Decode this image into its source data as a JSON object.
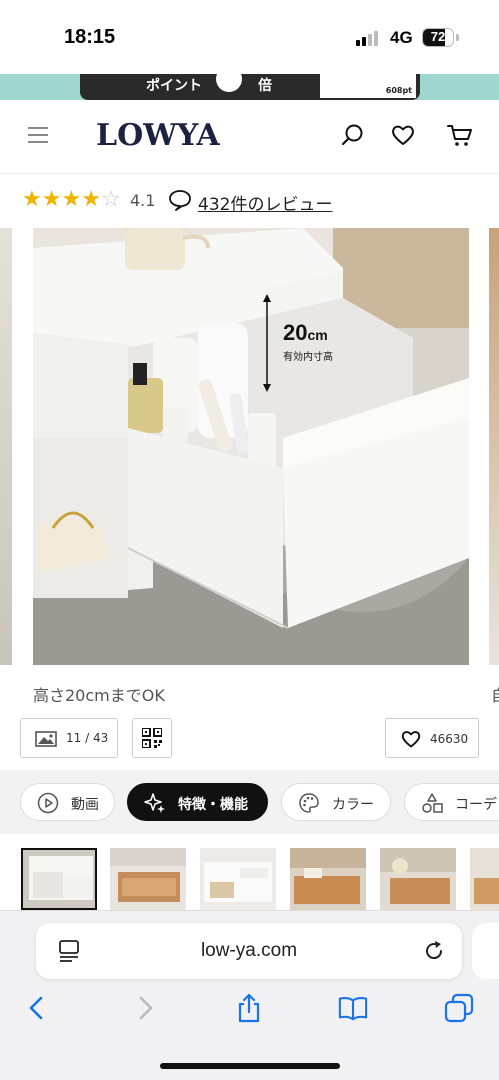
{
  "status_bar": {
    "time": "18:15",
    "network": "4G",
    "battery": "72",
    "battery_level": 0.72
  },
  "promo_banner": {
    "text_left": "ポイント",
    "text_right": "倍",
    "card_value": "608pt"
  },
  "header": {
    "logo": "LOWYA"
  },
  "rating": {
    "stars_filled": 4,
    "stars_total": 5,
    "value": "4.1",
    "review_link": "432件のレビュー"
  },
  "product_image": {
    "dimension_value": "20",
    "dimension_unit": "cm",
    "dimension_note": "有効内寸高",
    "caption": "高さ20cmまでOK",
    "caption_next": "自"
  },
  "gallery_controls": {
    "counter": "11 / 43",
    "favorites": "46630"
  },
  "tabs": [
    {
      "label": "動画",
      "icon": "play-icon"
    },
    {
      "label": "特徴・機能",
      "icon": "sparkle-icon"
    },
    {
      "label": "カラー",
      "icon": "palette-icon"
    },
    {
      "label": "コーデ",
      "icon": "shapes-icon"
    }
  ],
  "browser": {
    "address": "low-ya.com"
  },
  "colors": {
    "brand_navy": "#1b2340",
    "star": "#f0b400",
    "promo_teal": "#9fd7cf",
    "ios_blue": "#1a73e8"
  }
}
